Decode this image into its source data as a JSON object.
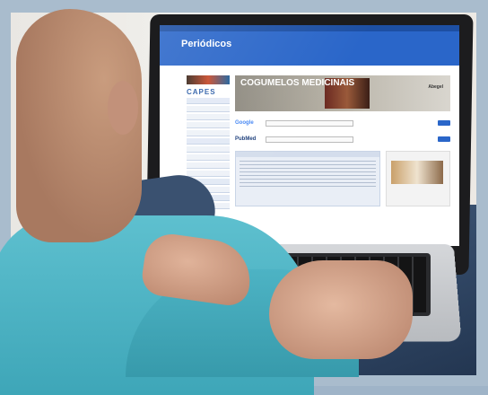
{
  "screen": {
    "site_title": "Periódicos",
    "capes_logo": "CAPES",
    "banner_title": "COGUMELOS MEDICINAIS",
    "banner_brand": "Abegel",
    "search_engines": [
      "Google",
      "PubMed"
    ]
  }
}
